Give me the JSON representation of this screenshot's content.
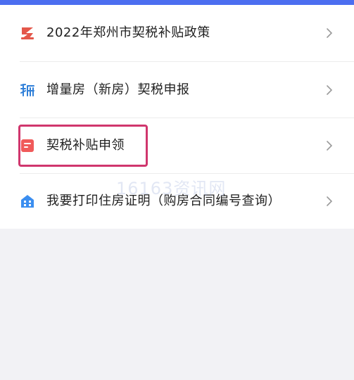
{
  "menu": {
    "items": [
      {
        "label": "2022年郑州市契税补贴政策",
        "icon": "policy-icon"
      },
      {
        "label": "增量房（新房）契税申报",
        "icon": "tax-icon"
      },
      {
        "label": "契税补贴申领",
        "icon": "document-icon"
      },
      {
        "label": "我要打印住房证明（购房合同编号查询）",
        "icon": "building-icon"
      }
    ],
    "chevron": "›"
  },
  "watermark": "16163资讯网",
  "colors": {
    "header_blue": "#4c6ef0",
    "highlight": "#d0366d",
    "policy_icon": "#e4574a",
    "tax_icon": "#2f7fd8",
    "doc_icon": "#f05a5a",
    "building_icon": "#3b8ef0"
  }
}
